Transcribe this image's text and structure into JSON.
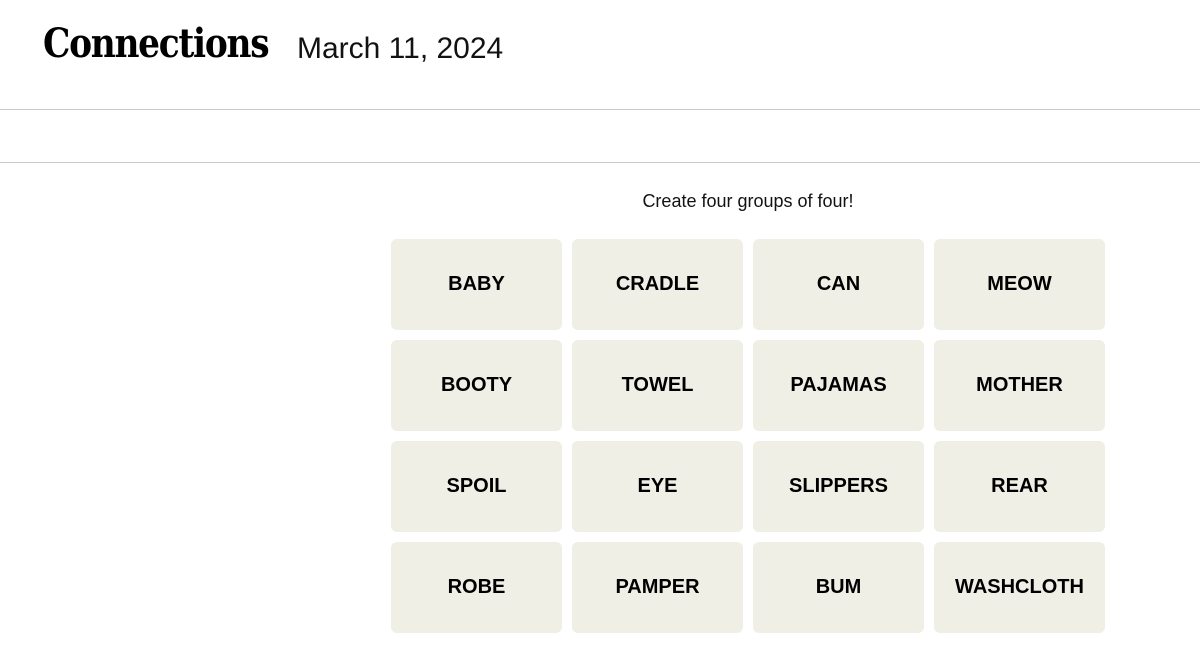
{
  "header": {
    "title": "Connections",
    "date": "March 11, 2024"
  },
  "game": {
    "instruction": "Create four groups of four!",
    "tile_color": "#efefe6",
    "tiles": [
      "BABY",
      "CRADLE",
      "CAN",
      "MEOW",
      "BOOTY",
      "TOWEL",
      "PAJAMAS",
      "MOTHER",
      "SPOIL",
      "EYE",
      "SLIPPERS",
      "REAR",
      "ROBE",
      "PAMPER",
      "BUM",
      "WASHCLOTH"
    ]
  }
}
